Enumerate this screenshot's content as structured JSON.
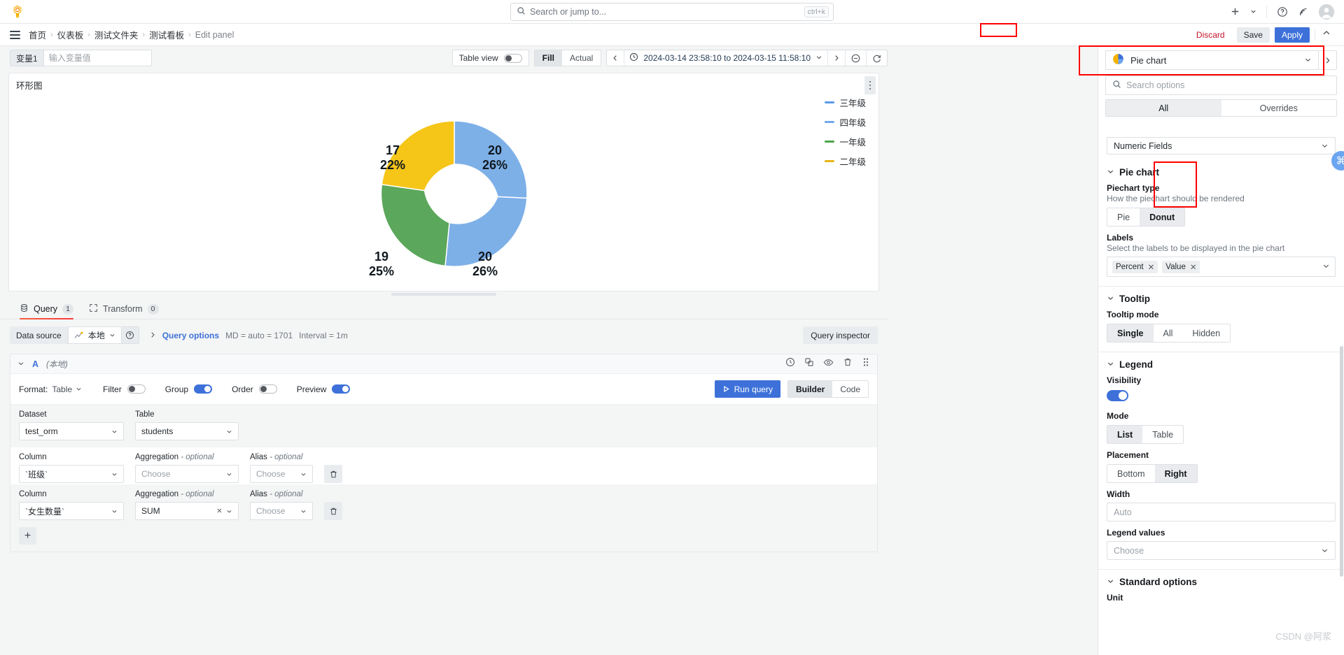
{
  "topnav": {
    "logo_icon": "grafana-logo",
    "search": {
      "placeholder": "Search or jump to...",
      "shortcut": "ctrl+k",
      "icon": "search-icon"
    },
    "add_label": "+",
    "icons": [
      "plus-icon",
      "chevron-down-icon",
      "help-circle-icon",
      "news-rss-icon",
      "user-avatar-icon"
    ]
  },
  "breadcrumb": {
    "menu_icon": "hamburger-menu-icon",
    "items": [
      {
        "label": "首页"
      },
      {
        "label": "仪表板"
      },
      {
        "label": "测试文件夹"
      },
      {
        "label": "测试看板"
      },
      {
        "label": "Edit panel"
      }
    ],
    "separator": "›",
    "actions": {
      "discard": "Discard",
      "save": "Save",
      "apply": "Apply",
      "collapse_icon": "chevron-up-icon"
    }
  },
  "variables": [
    {
      "label": "变量1",
      "value": "",
      "placeholder": "输入变量值"
    }
  ],
  "toolbar": {
    "table_view_label": "Table view",
    "table_view_on": false,
    "fill_actual": {
      "options": [
        "Fill",
        "Actual"
      ],
      "selected": "Fill"
    },
    "time_prev_icon": "chevron-left-icon",
    "time_next_icon": "chevron-right-icon",
    "clock_icon": "clock-icon",
    "time_range": "2024-03-14 23:58:10 to 2024-03-15 11:58:10",
    "zoom_out_icon": "zoom-out-icon",
    "refresh_icon": "refresh-icon"
  },
  "panel": {
    "title": "环形图",
    "menu_icon": "panel-menu-icon"
  },
  "chart_data": {
    "type": "pie",
    "variant": "donut",
    "title": "环形图",
    "labels": [
      "三年级",
      "四年级",
      "一年级",
      "二年级"
    ],
    "values": [
      20,
      20,
      19,
      17
    ],
    "percents": [
      "26%",
      "26%",
      "25%",
      "22%"
    ],
    "colors": [
      "#7EB0E8",
      "#7EB0E8",
      "#5BA75B",
      "#F5C518"
    ],
    "slices": [
      {
        "name": "三年级",
        "value": 20,
        "percent": "26%",
        "color": "#7EB0E8"
      },
      {
        "name": "四年级",
        "value": 20,
        "percent": "26%",
        "color": "#7EB0E8"
      },
      {
        "name": "一年级",
        "value": 19,
        "percent": "25%",
        "color": "#5BA75B"
      },
      {
        "name": "二年级",
        "value": 17,
        "percent": "22%",
        "color": "#F5C518"
      }
    ],
    "legend": {
      "position": "right",
      "entries": [
        {
          "label": "三年级",
          "color": "#5A9BE8"
        },
        {
          "label": "四年级",
          "color": "#6FA8ED"
        },
        {
          "label": "一年级",
          "color": "#4CA64C"
        },
        {
          "label": "二年级",
          "color": "#E8B517"
        }
      ]
    },
    "labels_shown": [
      "Percent",
      "Value"
    ]
  },
  "tabs": [
    {
      "label": "Query",
      "count": "1",
      "icon": "database-icon",
      "active": true
    },
    {
      "label": "Transform",
      "count": "0",
      "icon": "transform-icon",
      "active": false
    }
  ],
  "query": {
    "data_source_label": "Data source",
    "data_source_value": "本地",
    "help_icon": "help-circle-icon",
    "query_options_label": "Query options",
    "query_options_meta_md": "MD = auto = 1701",
    "query_options_meta_interval": "Interval = 1m",
    "query_inspector_label": "Query inspector",
    "row": {
      "ref_id": "A",
      "datasource": "(本地)",
      "icons": [
        "clock-icon",
        "copy-icon",
        "eye-icon",
        "trash-icon",
        "drag-icon"
      ],
      "format_label": "Format:",
      "format_value": "Table",
      "toggles": [
        {
          "label": "Filter",
          "on": false
        },
        {
          "label": "Group",
          "on": true
        },
        {
          "label": "Order",
          "on": false
        },
        {
          "label": "Preview",
          "on": true
        }
      ],
      "run_query_label": "Run query",
      "mode": {
        "options": [
          "Builder",
          "Code"
        ],
        "selected": "Builder"
      }
    },
    "dataset_label": "Dataset",
    "dataset_value": "test_orm",
    "table_label": "Table",
    "table_value": "students",
    "columns": [
      {
        "column_label": "Column",
        "column_value": "`班级`",
        "aggregation_label": "Aggregation",
        "aggregation_optional": "- optional",
        "aggregation_value": "Choose",
        "aggregation_is_placeholder": true,
        "alias_label": "Alias",
        "alias_optional": "- optional",
        "alias_value": "Choose",
        "alias_is_placeholder": true
      },
      {
        "column_label": "Column",
        "column_value": "`女生数量`",
        "aggregation_label": "Aggregation",
        "aggregation_optional": "- optional",
        "aggregation_value": "SUM",
        "aggregation_is_placeholder": false,
        "alias_label": "Alias",
        "alias_optional": "- optional",
        "alias_value": "Choose",
        "alias_is_placeholder": true
      }
    ],
    "add_button": "+"
  },
  "options": {
    "viz_name": "Pie chart",
    "viz_icon": "pie-chart-icon",
    "viz_chevron_icon": "chevron-down-icon",
    "viz_open_icon": "chevron-right-icon",
    "search_placeholder": "Search options",
    "search_icon": "search-icon",
    "tabs": {
      "options": [
        "All",
        "Overrides"
      ],
      "selected": "All"
    },
    "numeric_fields_value": "Numeric Fields",
    "sections": {
      "pie_chart": {
        "title": "Pie chart",
        "piechart_type_label": "Piechart type",
        "piechart_type_desc": "How the piechart should be rendered",
        "piechart_type_options": [
          "Pie",
          "Donut"
        ],
        "piechart_type_selected": "Donut",
        "labels_label": "Labels",
        "labels_desc": "Select the labels to be displayed in the pie chart",
        "labels_pills": [
          "Percent",
          "Value"
        ]
      },
      "tooltip": {
        "title": "Tooltip",
        "mode_label": "Tooltip mode",
        "mode_options": [
          "Single",
          "All",
          "Hidden"
        ],
        "mode_selected": "Single"
      },
      "legend": {
        "title": "Legend",
        "visibility_label": "Visibility",
        "visibility_on": true,
        "mode_label": "Mode",
        "mode_options": [
          "List",
          "Table"
        ],
        "mode_selected": "List",
        "placement_label": "Placement",
        "placement_options": [
          "Bottom",
          "Right"
        ],
        "placement_selected": "Right",
        "width_label": "Width",
        "width_placeholder": "Auto",
        "legend_values_label": "Legend values",
        "legend_values_placeholder": "Choose"
      },
      "standard_options": {
        "title": "Standard options",
        "unit_label": "Unit"
      }
    },
    "cmd_badge_icon": "command-icon"
  },
  "watermark": "CSDN @阿浆",
  "colors": {
    "accent_blue": "#3d71d9",
    "danger_red": "#c4162a",
    "annotation_red": "#ff0000"
  }
}
